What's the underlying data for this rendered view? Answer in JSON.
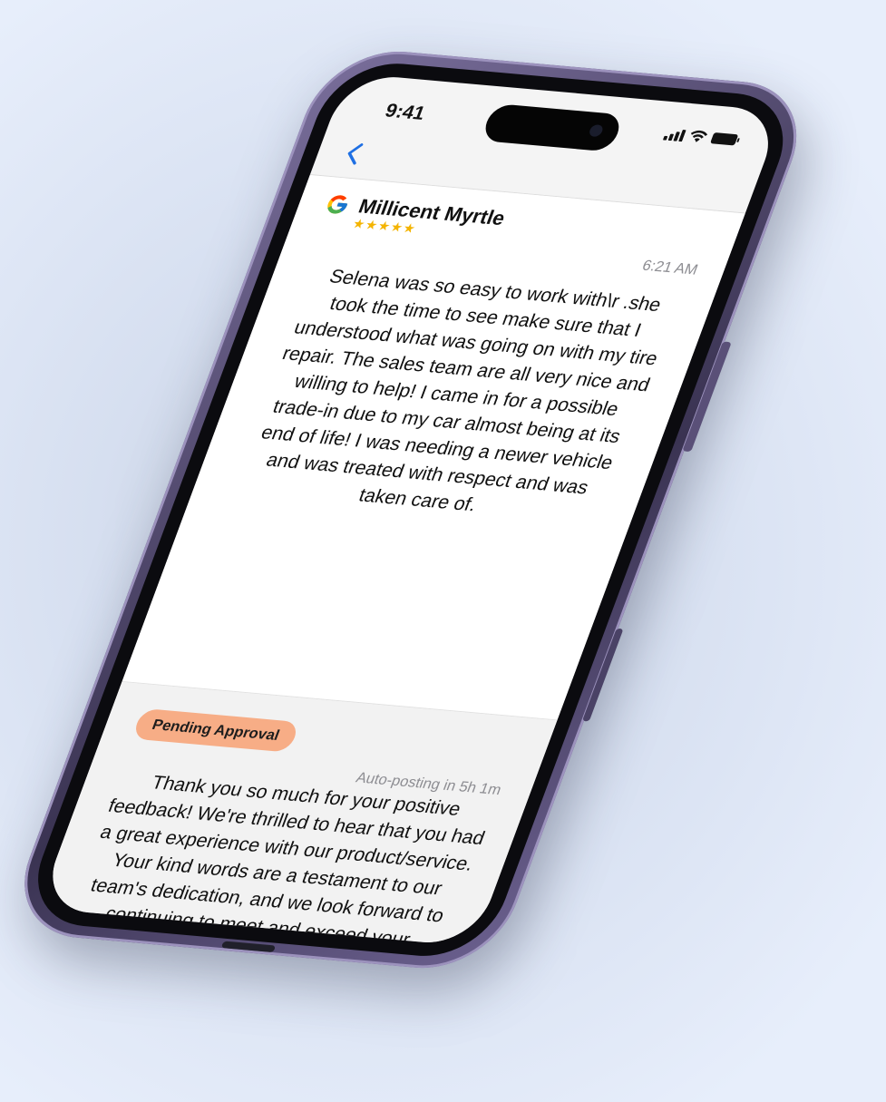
{
  "status_bar": {
    "time": "9:41",
    "icons": [
      "signal-icon",
      "wifi-icon",
      "battery-icon"
    ]
  },
  "nav": {
    "back_icon": "chevron-left-icon",
    "back_glyph": "‹"
  },
  "review": {
    "source_icon": "google-icon",
    "reviewer_name": "Millicent Myrtle",
    "rating": 5,
    "stars": "★★★★★",
    "time": "6:21 AM",
    "text": "Selena was so easy to work with\\r .she took the time to see make sure that I understood what was going on with my tire repair. The sales team are all very nice and willing to help! I came in for a possible trade-in due to my car almost being at its end of life! I was needing a newer vehicle and was treated with respect and was taken care of."
  },
  "reply": {
    "status_badge": "Pending Approval",
    "auto_posting": "Auto-posting in 5h 1m",
    "text": "Thank you so much for your positive feedback! We're thrilled to hear that you had a great experience with our product/service. Your kind words are a testament to our team's dedication, and we look forward to continuing to meet and exceed your expectations in the future."
  },
  "colors": {
    "accent_blue": "#1e6fe3",
    "star_yellow": "#f4b400",
    "pending_badge": "#f7ad86",
    "phone_frame": "#4d4568",
    "background": "#e7eefb"
  }
}
